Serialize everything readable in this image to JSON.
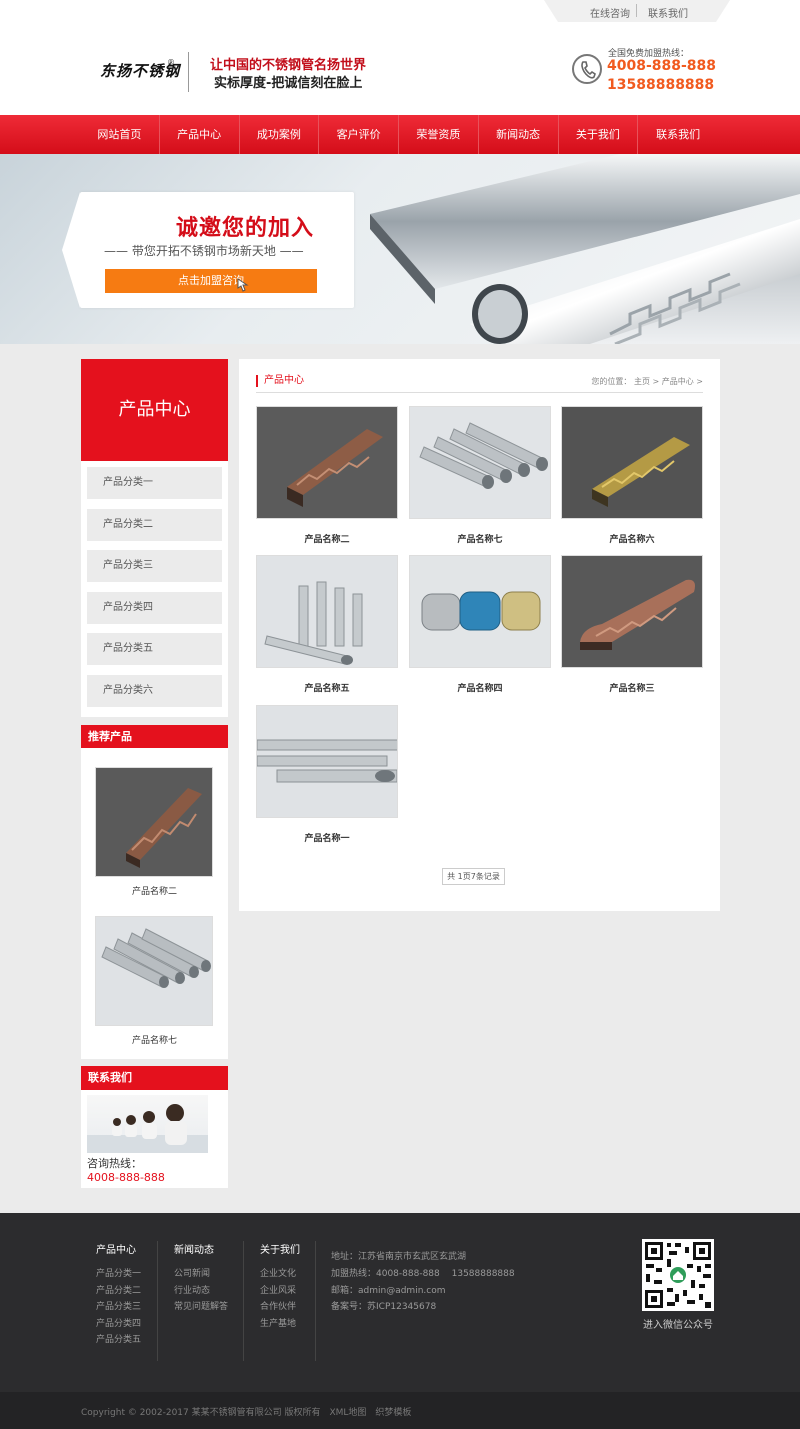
{
  "topbar": {
    "links": [
      "在线咨询",
      "联系我们"
    ]
  },
  "header": {
    "logo_text": "东扬不锈钢",
    "logo_mark": "®",
    "slogan_line1": "让中国的不锈钢管名扬世界",
    "slogan_line2": "实标厚度-把诚信刻在脸上",
    "hotline_label": "全国免费加盟热线：",
    "hotline_1": "4008-888-888",
    "hotline_2": "13588888888"
  },
  "nav": {
    "items": [
      "网站首页",
      "产品中心",
      "成功案例",
      "客户评价",
      "荣誉资质",
      "新闻动态",
      "关于我们",
      "联系我们"
    ]
  },
  "banner": {
    "title": "诚邀您的加入",
    "subtitle": "—— 带您开拓不锈钢市场新天地 ——",
    "button": "点击加盟咨询"
  },
  "sidebar": {
    "title": "产品中心",
    "categories": [
      "产品分类一",
      "产品分类二",
      "产品分类三",
      "产品分类四",
      "产品分类五",
      "产品分类六"
    ],
    "recommend_title": "推荐产品",
    "recommend": [
      "产品名称二",
      "产品名称七"
    ],
    "contact_title": "联系我们",
    "contact_label": "咨询热线：",
    "contact_phone": "4008-888-888"
  },
  "main": {
    "title": "产品中心",
    "breadcrumb": "您的位置： 主页 > 产品中心 >",
    "products": [
      "产品名称二",
      "产品名称七",
      "产品名称六",
      "产品名称五",
      "产品名称四",
      "产品名称三",
      "产品名称一"
    ],
    "pager": "共 1页7条记录"
  },
  "footer": {
    "col1": {
      "title": "产品中心",
      "items": [
        "产品分类一",
        "产品分类二",
        "产品分类三",
        "产品分类四",
        "产品分类五"
      ]
    },
    "col2": {
      "title": "新闻动态",
      "items": [
        "公司新闻",
        "行业动态",
        "常见问题解答"
      ]
    },
    "col3": {
      "title": "关于我们",
      "items": [
        "企业文化",
        "企业风采",
        "合作伙伴",
        "生产基地"
      ]
    },
    "address": "地址：江苏省南京市玄武区玄武湖",
    "hotline": "加盟热线：4008-888-888　 13588888888",
    "email": "邮箱：admin@admin.com",
    "icp": "备案号：苏ICP12345678",
    "qr_caption": "进入微信公众号",
    "copyright": "Copyright © 2002-2017 某某不锈钢管有限公司 版权所有　XML地图　织梦模板"
  }
}
